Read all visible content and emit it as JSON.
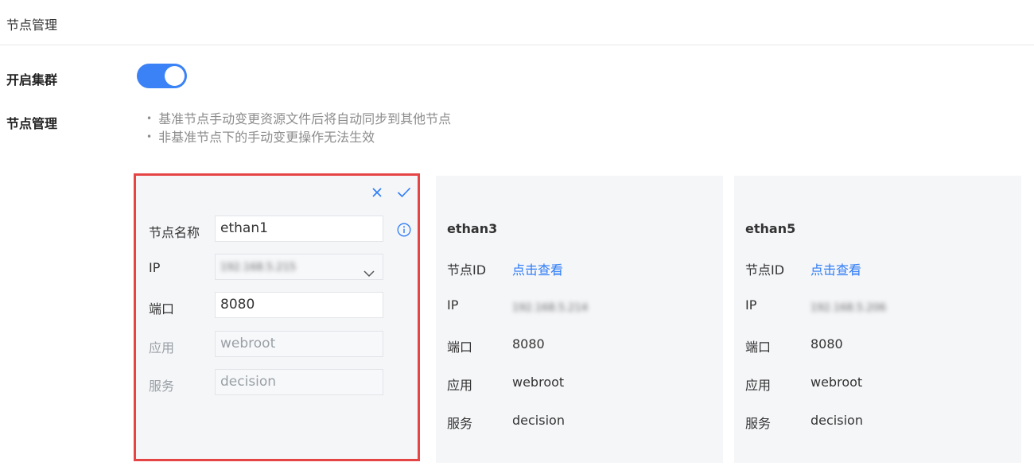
{
  "header": {
    "title": "节点管理"
  },
  "cluster": {
    "label": "开启集群",
    "enabled": true
  },
  "node_management": {
    "label": "节点管理",
    "notes": [
      "基准节点手动变更资源文件后将自动同步到其他节点",
      "非基准节点下的手动变更操作无法生效"
    ]
  },
  "edit_card": {
    "fields": {
      "name_label": "节点名称",
      "name_value": "ethan1",
      "ip_label": "IP",
      "ip_value": "192.168.5.215",
      "port_label": "端口",
      "port_value": "8080",
      "app_label": "应用",
      "app_value": "webroot",
      "service_label": "服务",
      "service_value": "decision"
    }
  },
  "nodes": [
    {
      "name": "ethan3",
      "id_label": "节点ID",
      "id_link": "点击查看",
      "ip_label": "IP",
      "ip_value": "192.168.5.214",
      "port_label": "端口",
      "port_value": "8080",
      "app_label": "应用",
      "app_value": "webroot",
      "service_label": "服务",
      "service_value": "decision"
    },
    {
      "name": "ethan5",
      "id_label": "节点ID",
      "id_link": "点击查看",
      "ip_label": "IP",
      "ip_value": "192.168.5.206",
      "port_label": "端口",
      "port_value": "8080",
      "app_label": "应用",
      "app_value": "webroot",
      "service_label": "服务",
      "service_value": "decision"
    }
  ],
  "colors": {
    "accent": "#2e7cf6",
    "toggle_on": "#3b82f6",
    "highlight_border": "#e64545"
  },
  "icons": {
    "cancel": "close-icon",
    "confirm": "check-icon",
    "info": "info-icon",
    "dropdown": "chevron-down-icon"
  }
}
